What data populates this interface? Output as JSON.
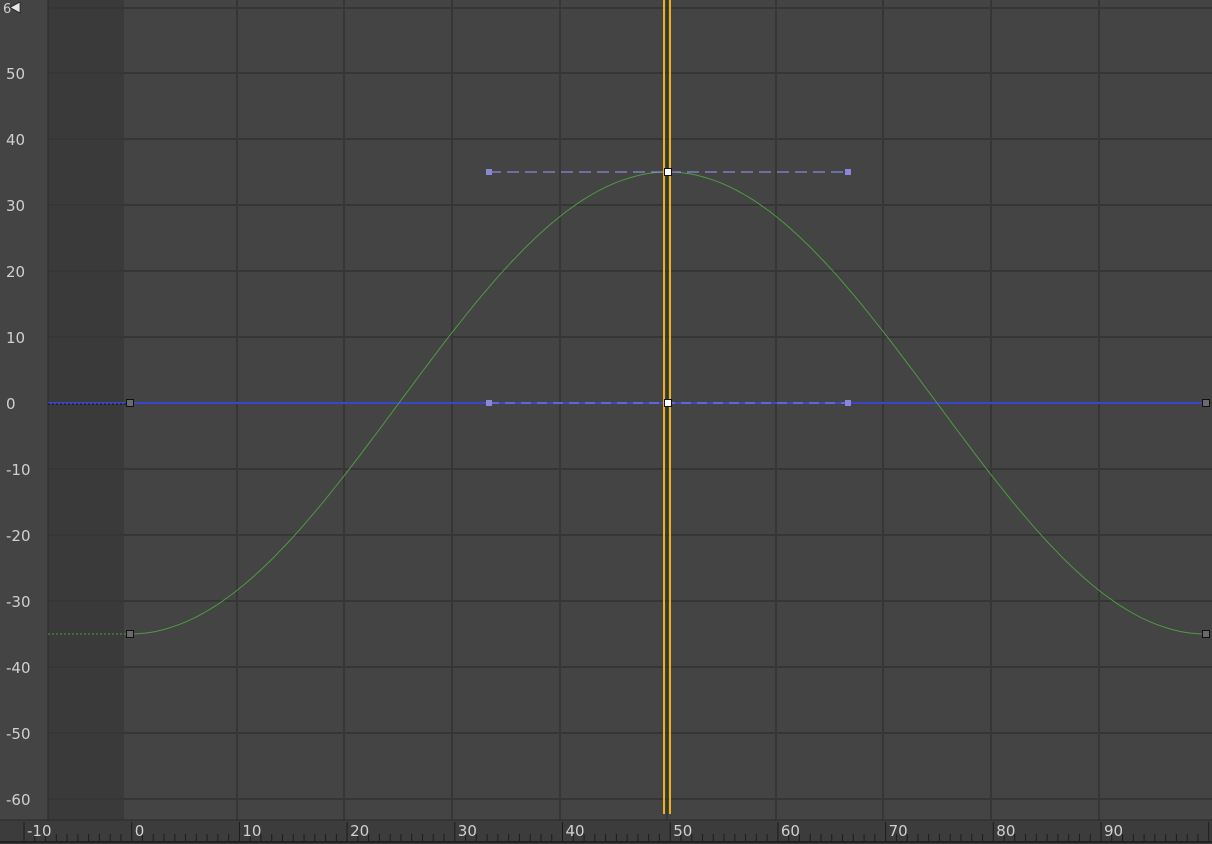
{
  "editor": {
    "corner_icon": "keyframe-nav-icon",
    "corner_label": "6",
    "x_axis": {
      "min": -10,
      "max": 100,
      "major_ticks": [
        -10,
        0,
        10,
        20,
        30,
        40,
        50,
        60,
        70,
        80,
        90
      ],
      "tick_labels": [
        "-10",
        "0",
        "10",
        "20",
        "30",
        "40",
        "50",
        "60",
        "70",
        "80",
        "90"
      ],
      "minor_step": 1
    },
    "y_axis": {
      "min": -63,
      "max": 61,
      "ticks": [
        50,
        40,
        30,
        20,
        10,
        0,
        -10,
        -20,
        -30,
        -40,
        -50,
        -60
      ],
      "tick_labels": [
        "50",
        "40",
        "30",
        "20",
        "10",
        "0",
        "-10",
        "-20",
        "-30",
        "-40",
        "-50",
        "-60"
      ]
    },
    "inactive_range": {
      "from": -10,
      "to": 0
    },
    "time_slider": {
      "frame": 49.6,
      "color": "#e8b21a"
    },
    "curves": [
      {
        "id": "green",
        "color": "#4f9a43",
        "keys": [
          {
            "frame": 0,
            "value": -35,
            "selected": false
          },
          {
            "frame": 50,
            "value": 35,
            "selected": true
          },
          {
            "frame": 100,
            "value": -35,
            "selected": false
          }
        ],
        "tangent": {
          "in_frame": 33.3,
          "out_frame": 66.7,
          "value": 35
        },
        "pre_extrapolation_value": -35
      },
      {
        "id": "blue",
        "color": "#3a46c8",
        "keys": [
          {
            "frame": 0,
            "value": 0,
            "selected": false
          },
          {
            "frame": 50,
            "value": 0,
            "selected": true
          },
          {
            "frame": 100,
            "value": 0,
            "selected": false
          }
        ],
        "tangent": {
          "in_frame": 33.3,
          "out_frame": 66.7,
          "value": 0
        },
        "pre_extrapolation_value": 0
      }
    ],
    "colors": {
      "background": "#444444",
      "inactive": "#3a3a3a",
      "grid_major": "#363636",
      "grid_minor": "#4a4a4a",
      "axis_text": "#d0d0d0",
      "ruler": "#3c3c3c",
      "tangent": "#8a86d8",
      "key_fill": "#6a6a6a",
      "key_selected": "#ffffff"
    }
  }
}
